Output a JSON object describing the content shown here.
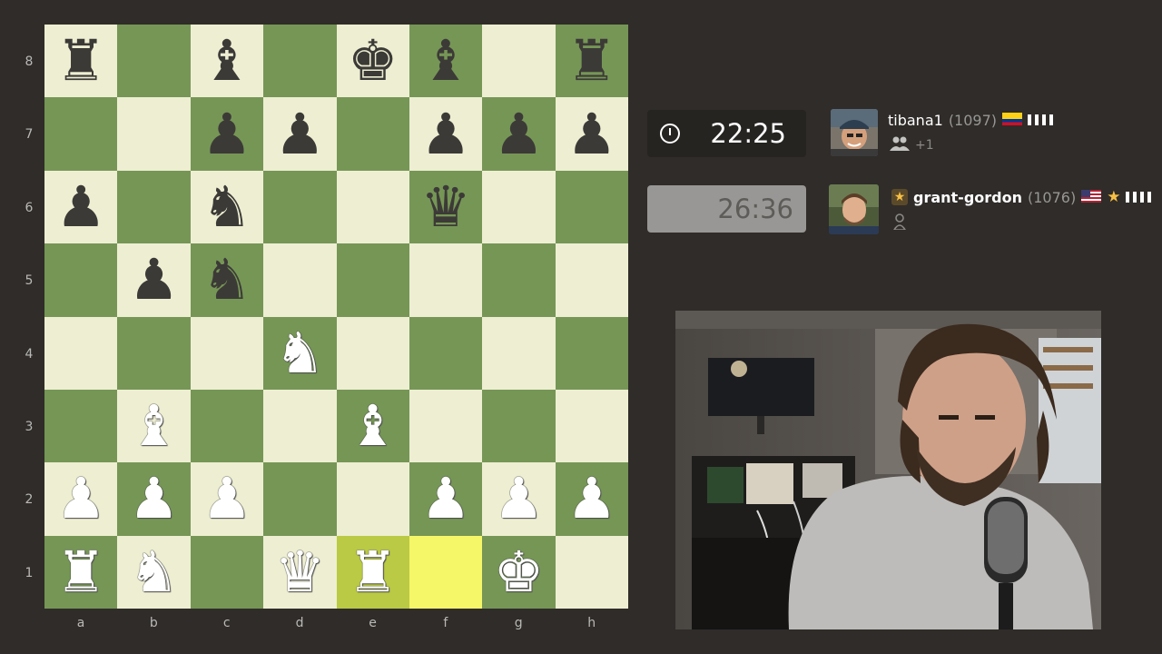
{
  "board": {
    "ranks": [
      "8",
      "7",
      "6",
      "5",
      "4",
      "3",
      "2",
      "1"
    ],
    "files": [
      "a",
      "b",
      "c",
      "d",
      "e",
      "f",
      "g",
      "h"
    ],
    "highlighted": [
      "e1",
      "f1"
    ],
    "squares": [
      [
        "bR",
        "",
        "bB",
        "",
        "bK",
        "bB",
        "",
        "bR"
      ],
      [
        "",
        "",
        "bP",
        "bP",
        "",
        "bP",
        "bP",
        "bP"
      ],
      [
        "bP",
        "",
        "bN",
        "",
        "",
        "bQ",
        "",
        ""
      ],
      [
        "",
        "bP",
        "bN",
        "",
        "",
        "",
        "",
        ""
      ],
      [
        "",
        "",
        "",
        "wN",
        "",
        "",
        "",
        ""
      ],
      [
        "",
        "wB",
        "",
        "",
        "wB",
        "",
        "",
        ""
      ],
      [
        "wP",
        "wP",
        "wP",
        "",
        "",
        "wP",
        "wP",
        "wP"
      ],
      [
        "wR",
        "wN",
        "",
        "wQ",
        "wR",
        "",
        "wK",
        ""
      ]
    ]
  },
  "glyphs": {
    "K": "♚",
    "Q": "♛",
    "R": "♜",
    "B": "♝",
    "N": "♞",
    "P": "♟"
  },
  "colors": {
    "light": "#eeeed2",
    "dark": "#769656",
    "highlight_light": "#f6f669",
    "highlight_dark": "#baca44"
  },
  "top_player": {
    "clock": "22:25",
    "name": "tibana1",
    "rating": "(1097)",
    "flag": "colombia-flag",
    "sub_text": "+1",
    "sub_icon": "friends-icon"
  },
  "bottom_player": {
    "clock": "26:36",
    "name": "grant-gordon",
    "rating": "(1076)",
    "flag": "usa-flag",
    "sub_icon": "user-icon"
  }
}
